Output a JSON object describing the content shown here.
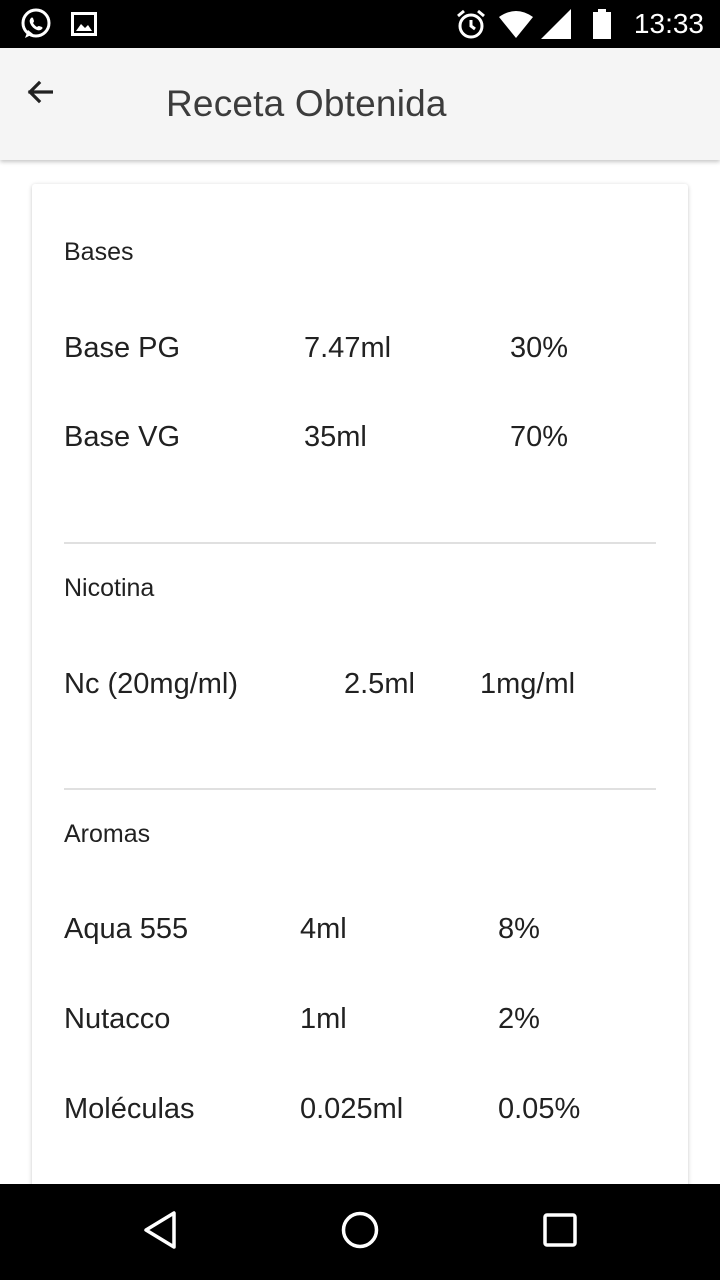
{
  "status_bar": {
    "time": "13:33",
    "icons": [
      "whatsapp-icon",
      "gallery-icon",
      "alarm-icon",
      "wifi-icon",
      "signal-icon",
      "battery-icon"
    ]
  },
  "app_bar": {
    "back_icon": "arrow-left-icon",
    "title": "Receta Obtenida"
  },
  "sections": {
    "bases": {
      "title": "Bases",
      "rows": [
        {
          "name": "Base PG",
          "amount": "7.47ml",
          "value": "30%"
        },
        {
          "name": "Base VG",
          "amount": "35ml",
          "value": "70%"
        }
      ]
    },
    "nicotina": {
      "title": "Nicotina",
      "rows": [
        {
          "name": "Nc (20mg/ml)",
          "amount": "2.5ml",
          "value": "1mg/ml"
        }
      ]
    },
    "aromas": {
      "title": "Aromas",
      "rows": [
        {
          "name": "Aqua 555",
          "amount": "4ml",
          "value": "8%"
        },
        {
          "name": "Nutacco",
          "amount": "1ml",
          "value": "2%"
        },
        {
          "name": "Moléculas",
          "amount": "0.025ml",
          "value": "0.05%"
        }
      ]
    }
  },
  "nav_bar": {
    "icons": [
      "back-triangle-icon",
      "home-circle-icon",
      "recents-square-icon"
    ]
  },
  "colors": {
    "status_bar": "#000000",
    "app_bar": "#f5f5f5",
    "title_text": "#3c3c3c",
    "body_text": "#212121",
    "divider": "#e0e0e0"
  }
}
